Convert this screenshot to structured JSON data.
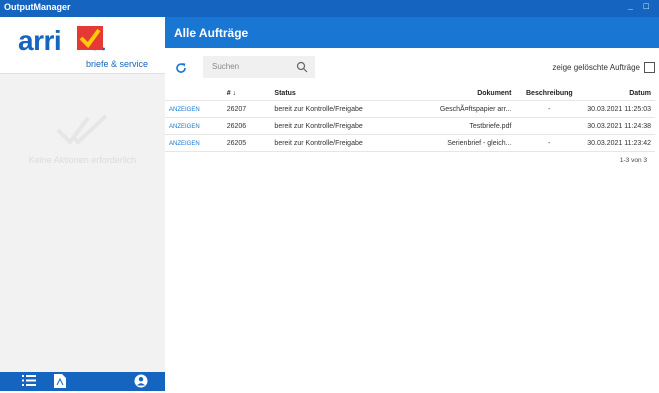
{
  "window": {
    "title": "OutputManager",
    "controls": "_ □"
  },
  "logo": {
    "text": "arri a",
    "subtitle": "briefe & service"
  },
  "sidebar": {
    "empty_text": "Keine Aktionen erforderlich"
  },
  "nav": {
    "icons": [
      "list-icon",
      "pdf-icon",
      "user-icon"
    ]
  },
  "header": {
    "title": "Alle Aufträge"
  },
  "toolbar": {
    "search_placeholder": "Suchen",
    "deleted_label": "zeige gelöschte Aufträge"
  },
  "table": {
    "columns": [
      "",
      "# ↓",
      "Status",
      "Dokument",
      "Beschreibung",
      "Datum"
    ],
    "rows": [
      {
        "action": "ANZEIGEN",
        "id": "26207",
        "status": "bereit zur Kontrolle/Freigabe",
        "document": "GeschÃ¤ftspapier arr...",
        "description": "-",
        "date": "30.03.2021 11:25:03"
      },
      {
        "action": "ANZEIGEN",
        "id": "26206",
        "status": "bereit zur Kontrolle/Freigabe",
        "document": "Testbriefe.pdf",
        "description": "",
        "date": "30.03.2021 11:24:38"
      },
      {
        "action": "ANZEIGEN",
        "id": "26205",
        "status": "bereit zur Kontrolle/Freigabe",
        "document": "Serienbrief - gleich...",
        "description": "-",
        "date": "30.03.2021 11:23:42"
      }
    ]
  },
  "pager": {
    "text": "1-3 von 3"
  }
}
